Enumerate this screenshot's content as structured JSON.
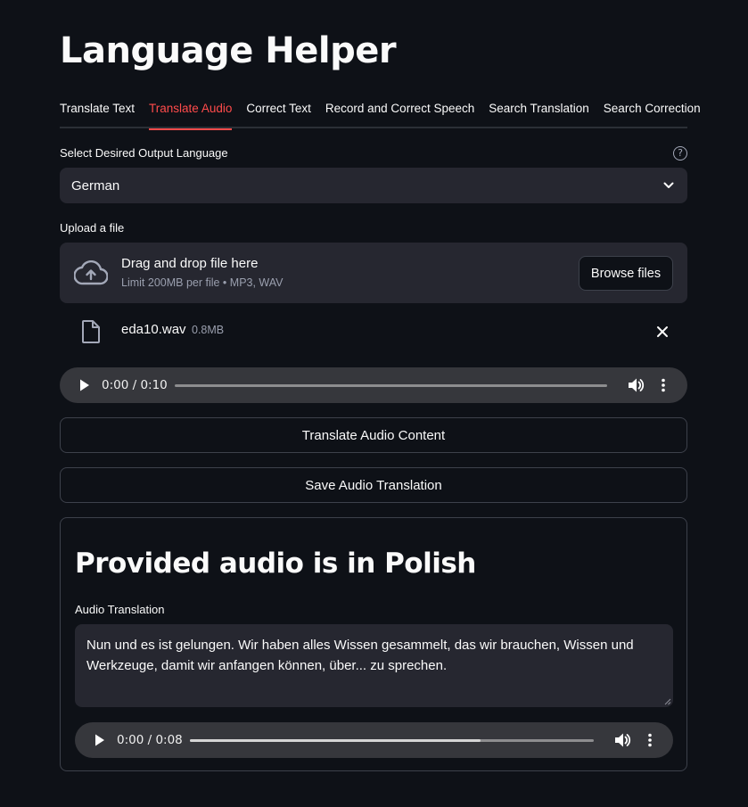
{
  "app": {
    "title": "Language Helper"
  },
  "tabs": [
    {
      "label": "Translate Text",
      "active": false
    },
    {
      "label": "Translate Audio",
      "active": true
    },
    {
      "label": "Correct Text",
      "active": false
    },
    {
      "label": "Record and Correct Speech",
      "active": false
    },
    {
      "label": "Search Translation",
      "active": false
    },
    {
      "label": "Search Correction",
      "active": false
    }
  ],
  "output_language": {
    "label": "Select Desired Output Language",
    "help_glyph": "?",
    "selected": "German"
  },
  "uploader": {
    "label": "Upload a file",
    "drag_text": "Drag and drop file here",
    "limit_text": "Limit 200MB per file • MP3, WAV",
    "browse_label": "Browse files",
    "file": {
      "name": "eda10.wav",
      "size": "0.8MB"
    }
  },
  "source_audio": {
    "time": "0:00 / 0:10",
    "progress": 0
  },
  "buttons": {
    "translate": "Translate Audio Content",
    "save": "Save Audio Translation"
  },
  "result": {
    "heading": "Provided audio is in Polish",
    "translation_label": "Audio Translation",
    "translation_text": "Nun und es ist gelungen. Wir haben alles Wissen gesammelt, das wir brauchen, Wissen und Werkzeuge, damit wir anfangen können, über... zu sprechen.",
    "audio": {
      "time": "0:00 / 0:08",
      "buffered": 0.72
    }
  },
  "colors": {
    "background": "#0e1117",
    "accent": "#ff4b4b",
    "input_bg": "#262730",
    "player_bg": "#36373c"
  },
  "icons": {
    "help": "help-circle-icon",
    "chevron": "chevron-down-icon",
    "upload": "cloud-upload-icon",
    "file": "file-icon",
    "close": "close-icon",
    "play": "play-icon",
    "volume": "volume-icon",
    "more": "more-vertical-icon"
  }
}
